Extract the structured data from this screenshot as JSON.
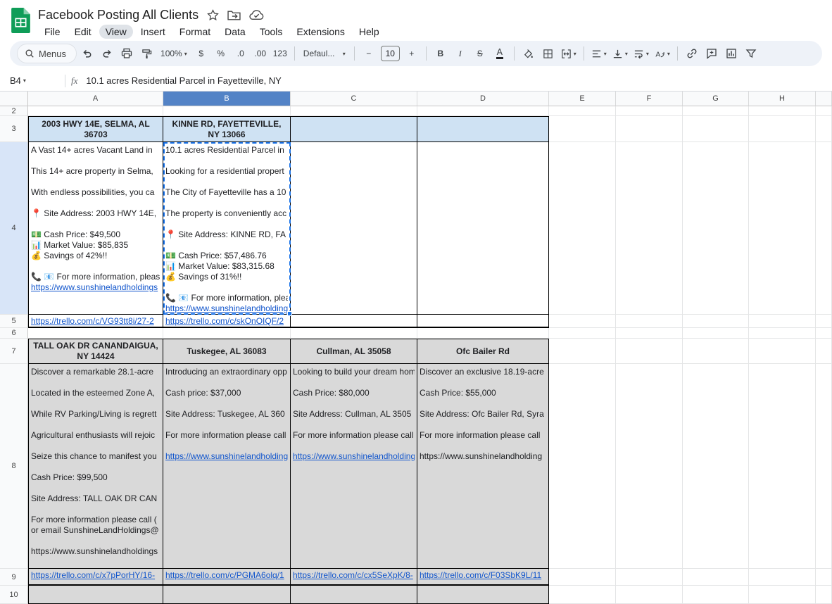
{
  "header": {
    "doc_title": "Facebook Posting All Clients",
    "menus": [
      "File",
      "Edit",
      "View",
      "Insert",
      "Format",
      "Data",
      "Tools",
      "Extensions",
      "Help"
    ],
    "active_menu": "View"
  },
  "toolbar": {
    "menus_label": "Menus",
    "zoom_value": "100%",
    "currency_glyph": "$",
    "percent_glyph": "%",
    "decrease_decimal_glyph": ".0",
    "increase_decimal_glyph": ".00",
    "more_formats_glyph": "123",
    "font_family_value": "Defaul...",
    "decrease_font_glyph": "−",
    "font_size_value": "10",
    "increase_font_glyph": "+",
    "bold_glyph": "B",
    "italic_glyph": "I",
    "strikethrough_glyph": "S",
    "text_color_glyph": "A"
  },
  "formula_bar": {
    "cell_ref": "B4",
    "fx_label": "fx",
    "value": "10.1 acres Residential Parcel in Fayetteville, NY"
  },
  "colors": {
    "link": "#1155cc",
    "active_cell_border": "#1a73e8",
    "selected_column_header": "#5383c6",
    "selected_row_gutter": "#d8e5f8",
    "header_fill_blue": "#cfe2f3",
    "header_fill_gray": "#d9d9d9"
  },
  "grid": {
    "column_headers": [
      "A",
      "B",
      "C",
      "D",
      "E",
      "F",
      "G",
      "H",
      ""
    ],
    "active_column": "B",
    "row_numbers": [
      "2",
      "3",
      "4",
      "5",
      "6",
      "7",
      "8",
      "9",
      "10"
    ],
    "active_row": "4",
    "cells": [
      {
        "r": "3",
        "c": "A",
        "kind": "header",
        "bg": "#cfe2f3",
        "text": "2003 HWY 14E, SELMA, AL 36703"
      },
      {
        "r": "3",
        "c": "B",
        "kind": "header",
        "bg": "#cfe2f3",
        "text": "KINNE RD, FAYETTEVILLE, NY 13066"
      },
      {
        "r": "3",
        "c": "C",
        "kind": "header",
        "bg": "#cfe2f3",
        "text": ""
      },
      {
        "r": "3",
        "c": "D",
        "kind": "header",
        "bg": "#cfe2f3",
        "text": ""
      },
      {
        "r": "4",
        "c": "A",
        "kind": "content",
        "lines": [
          {
            "text": "A Vast 14+ acres Vacant Land in"
          },
          {
            "text": ""
          },
          {
            "text": "This 14+ acre property in Selma,"
          },
          {
            "text": ""
          },
          {
            "text": "With endless possibilities, you ca"
          },
          {
            "text": ""
          },
          {
            "text": "📍 Site Address: 2003 HWY 14E,"
          },
          {
            "text": ""
          },
          {
            "text": "💵 Cash Price: $49,500"
          },
          {
            "text": "📊 Market Value: $85,835"
          },
          {
            "text": "💰 Savings of 42%!!"
          },
          {
            "text": ""
          },
          {
            "text": "📞 📧 For more information, pleas"
          },
          {
            "text": "https://www.sunshinelandholdings",
            "link": true
          }
        ]
      },
      {
        "r": "4",
        "c": "B",
        "kind": "content",
        "lines": [
          {
            "text": "10.1 acres Residential Parcel in"
          },
          {
            "text": ""
          },
          {
            "text": "Looking for a residential propert"
          },
          {
            "text": ""
          },
          {
            "text": "The City of Fayetteville has a 10"
          },
          {
            "text": ""
          },
          {
            "text": "The property is conveniently acc"
          },
          {
            "text": ""
          },
          {
            "text": "📍 Site Address: KINNE RD, FA"
          },
          {
            "text": ""
          },
          {
            "text": "💵 Cash Price: $57,486.76"
          },
          {
            "text": "📊 Market Value: $83,315.68"
          },
          {
            "text": "💰 Savings of 31%!!"
          },
          {
            "text": ""
          },
          {
            "text": "📞 📧 For more information, plea"
          },
          {
            "text": "https://www.sunshinelandholding",
            "link": true
          }
        ]
      },
      {
        "r": "4",
        "c": "C",
        "kind": "content",
        "lines": []
      },
      {
        "r": "4",
        "c": "D",
        "kind": "content",
        "lines": []
      },
      {
        "r": "5",
        "c": "A",
        "kind": "link",
        "thick_bottom": true,
        "text": "https://trello.com/c/VG93tt8i/27-2"
      },
      {
        "r": "5",
        "c": "B",
        "kind": "link",
        "thick_bottom": true,
        "text": "https://trello.com/c/skOnOIQF/2"
      },
      {
        "r": "5",
        "c": "C",
        "kind": "empty",
        "thick_bottom": true
      },
      {
        "r": "5",
        "c": "D",
        "kind": "empty",
        "thick_bottom": true
      },
      {
        "r": "7",
        "c": "A",
        "kind": "header",
        "bg": "#d9d9d9",
        "text": "TALL OAK DR CANANDAIGUA, NY 14424"
      },
      {
        "r": "7",
        "c": "B",
        "kind": "header",
        "bg": "#d9d9d9",
        "text": "Tuskegee, AL 36083"
      },
      {
        "r": "7",
        "c": "C",
        "kind": "header",
        "bg": "#d9d9d9",
        "text": "Cullman, AL 35058"
      },
      {
        "r": "7",
        "c": "D",
        "kind": "header",
        "bg": "#d9d9d9",
        "text": "Ofc Bailer Rd"
      },
      {
        "r": "8",
        "c": "A",
        "kind": "content",
        "bg": "#d9d9d9",
        "lines": [
          {
            "text": "Discover a remarkable 28.1-acre"
          },
          {
            "text": ""
          },
          {
            "text": "Located in the esteemed Zone A,"
          },
          {
            "text": ""
          },
          {
            "text": "While RV Parking/Living is regrett"
          },
          {
            "text": ""
          },
          {
            "text": "Agricultural enthusiasts will rejoic"
          },
          {
            "text": ""
          },
          {
            "text": "Seize this chance to manifest you"
          },
          {
            "text": ""
          },
          {
            "text": "Cash Price: $99,500"
          },
          {
            "text": ""
          },
          {
            "text": "Site Address: TALL OAK DR CAN"
          },
          {
            "text": ""
          },
          {
            "text": "For more information please call ("
          },
          {
            "text": "or email SunshineLandHoldings@"
          },
          {
            "text": ""
          },
          {
            "text": "https://www.sunshinelandholdings"
          }
        ]
      },
      {
        "r": "8",
        "c": "B",
        "kind": "content",
        "bg": "#d9d9d9",
        "lines": [
          {
            "text": "Introducing an extraordinary opp"
          },
          {
            "text": ""
          },
          {
            "text": "Cash price: $37,000"
          },
          {
            "text": ""
          },
          {
            "text": "Site Address: Tuskegee, AL 360"
          },
          {
            "text": ""
          },
          {
            "text": "For more information please call"
          },
          {
            "text": ""
          },
          {
            "text": "https://www.sunshinelandholding",
            "link": true
          }
        ]
      },
      {
        "r": "8",
        "c": "C",
        "kind": "content",
        "bg": "#d9d9d9",
        "lines": [
          {
            "text": "Looking to build your dream hom"
          },
          {
            "text": ""
          },
          {
            "text": "Cash Price: $80,000"
          },
          {
            "text": ""
          },
          {
            "text": "Site Address: Cullman, AL 3505"
          },
          {
            "text": ""
          },
          {
            "text": "For more information please call"
          },
          {
            "text": ""
          },
          {
            "text": "https://www.sunshinelandholding",
            "link": true
          }
        ]
      },
      {
        "r": "8",
        "c": "D",
        "kind": "content",
        "bg": "#d9d9d9",
        "lines": [
          {
            "text": "Discover an exclusive 18.19-acre"
          },
          {
            "text": ""
          },
          {
            "text": "Cash Price: $55,000"
          },
          {
            "text": ""
          },
          {
            "text": "Site Address: Ofc Bailer Rd, Syra"
          },
          {
            "text": ""
          },
          {
            "text": "For more information please call"
          },
          {
            "text": ""
          },
          {
            "text": "https://www.sunshinelandholding"
          }
        ]
      },
      {
        "r": "9",
        "c": "A",
        "kind": "link",
        "bg": "#d9d9d9",
        "thick_bottom": true,
        "text": "https://trello.com/c/x7pPorHY/16-"
      },
      {
        "r": "9",
        "c": "B",
        "kind": "link",
        "bg": "#d9d9d9",
        "thick_bottom": true,
        "text": "https://trello.com/c/PGMA6olq/1"
      },
      {
        "r": "9",
        "c": "C",
        "kind": "link",
        "bg": "#d9d9d9",
        "thick_bottom": true,
        "text": "https://trello.com/c/cx5SeXpK/8-"
      },
      {
        "r": "9",
        "c": "D",
        "kind": "link",
        "bg": "#d9d9d9",
        "thick_bottom": true,
        "text": "https://trello.com/c/F03SbK9L/11"
      },
      {
        "r": "10",
        "c": "A",
        "kind": "empty",
        "bg": "#d9d9d9"
      },
      {
        "r": "10",
        "c": "B",
        "kind": "empty",
        "bg": "#d9d9d9"
      },
      {
        "r": "10",
        "c": "C",
        "kind": "empty",
        "bg": "#d9d9d9"
      },
      {
        "r": "10",
        "c": "D",
        "kind": "empty",
        "bg": "#d9d9d9"
      }
    ]
  }
}
